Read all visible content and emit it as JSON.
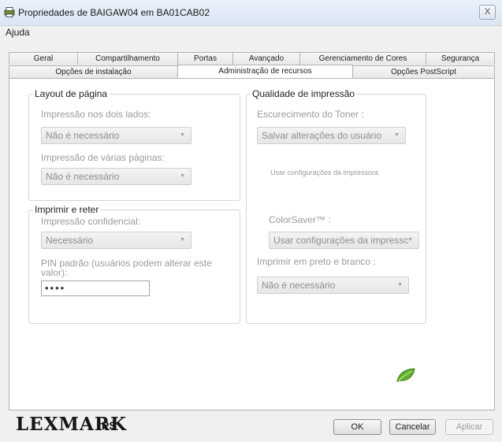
{
  "window": {
    "title": "Propriedades de BAIGAW04 em BA01CAB02",
    "close_label": "X"
  },
  "menu": {
    "help": "Ajuda"
  },
  "tabs": {
    "row1": [
      "Geral",
      "Compartilhamento",
      "Portas",
      "Avançado",
      "Gerenciamento de Cores",
      "Segurança"
    ],
    "row2": [
      "Opções de instalação",
      "Administração de recursos",
      "Opções PostScript"
    ],
    "active": "Administração de recursos"
  },
  "layout_group": {
    "title": "Layout de página",
    "duplex_label": "Impressão nos dois lados:",
    "duplex_value": "Não é necessário",
    "multipage_label": "Impressão de várias páginas:",
    "multipage_value": "Não é necessário"
  },
  "hold_group": {
    "title": "Imprimir e reter",
    "confidential_label": "Impressão confidencial:",
    "confidential_value": "Necessário",
    "pin_label": "PIN padrão (usuários podem alterar este valor):",
    "pin_value": "••••"
  },
  "quality_group": {
    "title": "Qualidade de impressão",
    "toner_label": "Escurecimento do Toner :",
    "toner_value": "Salvar alterações do usuário",
    "printer_settings_note": "Usar configurações da impressora",
    "colorsaver_label": "ColorSaver™ :",
    "colorsaver_value": "Usar configurações da impressc",
    "bw_label": "Imprimir em preto e branco :",
    "bw_value": "Não é necessário"
  },
  "branding": {
    "logo": "LEXMARK",
    "ps": "PS"
  },
  "buttons": {
    "ok": "OK",
    "cancel": "Cancelar",
    "apply": "Aplicar"
  },
  "icons": {
    "app": "printer-icon",
    "eco": "leaf-icon",
    "dropdown": "chevron-down-icon"
  }
}
